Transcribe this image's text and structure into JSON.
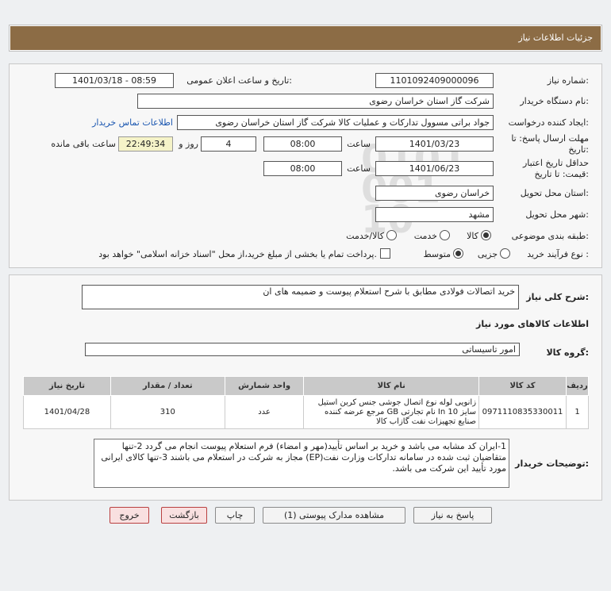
{
  "page": {
    "title": "جزئیات اطلاعات نیاز"
  },
  "form": {
    "need_number_label": "شماره نیاز:",
    "need_number": "1101092409000096",
    "announce_label": "تاریخ و ساعت اعلان عمومی:",
    "announce_value": "1401/03/18 - 08:59",
    "buyer_org_label": "نام دستگاه خریدار:",
    "buyer_org": "شرکت گاز استان خراسان رضوی",
    "creator_label": "ایجاد کننده درخواست:",
    "creator": "جواد براتی مسوول تدارکات و عملیات کالا شرکت گاز استان خراسان رضوی",
    "contact_link": "اطلاعات تماس خریدار",
    "reply_deadline_label_1": "مهلت ارسال پاسخ: تا",
    "reply_deadline_label_2": "تاریخ:",
    "reply_date": "1401/03/23",
    "time_label": "ساعت",
    "reply_time": "08:00",
    "days_value": "4",
    "days_label": "روز و",
    "remaining_time": "22:49:34",
    "remaining_label": "ساعت باقی مانده",
    "validity_label_1": "حداقل تاریخ اعتبار",
    "validity_label_2": "قیمت: تا تاریخ:",
    "validity_date": "1401/06/23",
    "validity_time": "08:00",
    "province_label": "استان محل تحویل:",
    "province": "خراسان رضوی",
    "city_label": "شهر محل تحویل:",
    "city": "مشهد",
    "category_label": "طبقه بندی موضوعی:",
    "category_options": [
      "کالا",
      "خدمت",
      "کالا/خدمت"
    ],
    "process_label": "نوع فرآیند خرید :",
    "process_options": [
      "جزیی",
      "متوسط"
    ],
    "payment_note": "پرداخت تمام یا بخشی از مبلغ خرید،از محل \"اسناد خزانه اسلامی\" خواهد بود."
  },
  "summary": {
    "label": "شرح کلی نیاز:",
    "value": "خرید اتصالات فولادی مطابق با شرح استعلام پیوست و ضمیمه های ان",
    "goods_heading": "اطلاعات کالاهای مورد نیاز",
    "group_label": "گروه کالا:",
    "group_value": "امور تاسیساتی"
  },
  "table": {
    "headers": [
      "ردیف",
      "کد کالا",
      "نام کالا",
      "واحد شمارش",
      "تعداد / مقدار",
      "تاریخ نیاز"
    ],
    "rows": [
      {
        "index": "1",
        "code": "0971110835330011",
        "name": "زانویی لوله نوع اتصال جوشی جنس کربن استیل سایز In 10 نام تجارتی GB مرجع عرضه کننده صنایع تجهیزات نفت گازاب کالا",
        "unit": "عدد",
        "qty": "310",
        "date": "1401/04/28"
      }
    ]
  },
  "notes": {
    "label": "توضیحات خریدار:",
    "text": "1-ایران کد مشابه می باشد و خرید بر اساس تأیید(مهر و امضاء) فرم استعلام پیوست انجام می گردد 2-تنها متقاضیان ثبت شده در سامانه تدارکات وزارت نفت(EP) مجاز به شرکت در استعلام می باشند 3-تنها کالای ایرانی مورد تأیید این شرکت می باشد."
  },
  "buttons": {
    "reply": "پاسخ به نیاز",
    "attachments": "مشاهده مدارک پیوستی (1)",
    "print": "چاپ",
    "back": "بازگشت",
    "exit": "خروج"
  },
  "watermark": {
    "brand": "ParsNamadData",
    "line1": "مرکز فراوری اطلاعات پارس نماد داده ها",
    "line2": "پایگاه خبر رسانی مناقصه و مزایده",
    "phone": "۰۲۱-۸۸۳۴۹۶۷۰"
  },
  "colors": {
    "header_bg": "#8c6c45",
    "link": "#1a56b0",
    "table_header": "#c9c9c9"
  }
}
